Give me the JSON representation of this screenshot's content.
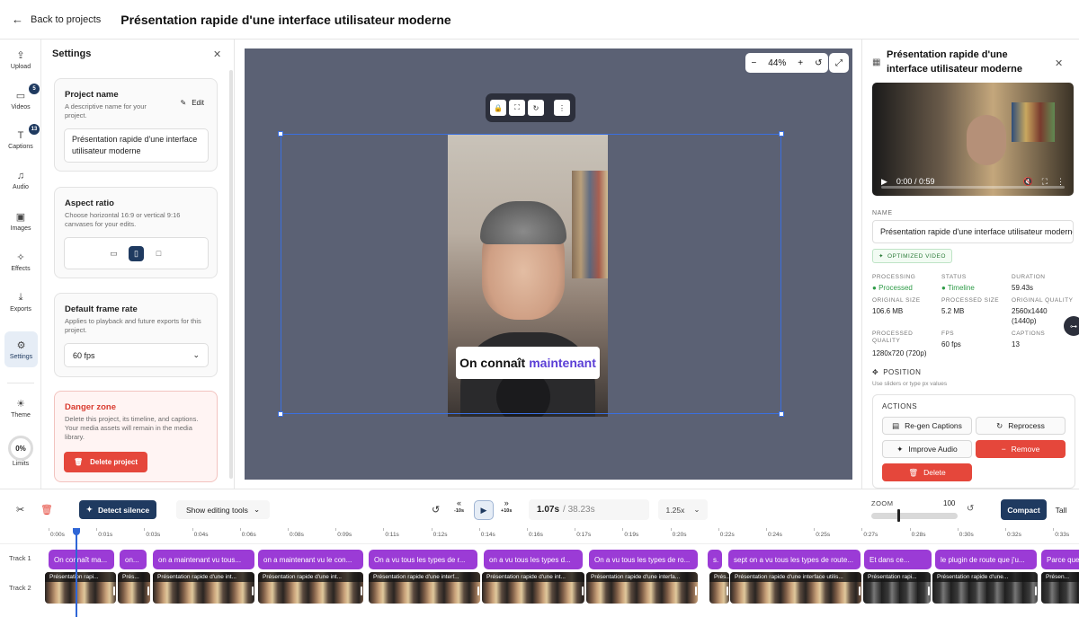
{
  "topbar": {
    "back_label": "Back to projects",
    "project_title": "Présentation rapide d'une interface utilisateur moderne"
  },
  "rail": {
    "items": [
      {
        "label": "Upload",
        "icon": "upload-icon"
      },
      {
        "label": "Videos",
        "icon": "video-icon",
        "badge": "5"
      },
      {
        "label": "Captions",
        "icon": "text-icon",
        "badge": "13"
      },
      {
        "label": "Audio",
        "icon": "music-icon"
      },
      {
        "label": "Images",
        "icon": "image-icon"
      },
      {
        "label": "Effects",
        "icon": "wand-icon"
      },
      {
        "label": "Exports",
        "icon": "download-icon"
      },
      {
        "label": "Settings",
        "icon": "gear-icon",
        "active": true
      }
    ],
    "theme_label": "Theme",
    "limits_value": "0%",
    "limits_label": "Limits"
  },
  "settings": {
    "title": "Settings",
    "project_name": {
      "heading": "Project name",
      "description": "A descriptive name for your project.",
      "edit_label": "Edit",
      "value": "Présentation rapide d'une interface utilisateur moderne"
    },
    "aspect_ratio": {
      "heading": "Aspect ratio",
      "description": "Choose horizontal 16:9 or vertical 9:16 canvases for your edits.",
      "selected": "vertical"
    },
    "frame_rate": {
      "heading": "Default frame rate",
      "description": "Applies to playback and future exports for this project.",
      "value": "60 fps"
    },
    "danger": {
      "heading": "Danger zone",
      "description": "Delete this project, its timeline, and captions. Your media assets will remain in the media library.",
      "button_label": "Delete project"
    }
  },
  "canvas": {
    "zoom_value": "44%",
    "caption_text": "On connaît",
    "caption_highlight": "maintenant"
  },
  "inspector": {
    "title": "Présentation rapide d'une interface utilisateur moderne",
    "player_time": "0:00 / 0:59",
    "name_label": "NAME",
    "name_value": "Présentation rapide d'une interface utilisateur moderne",
    "optimized_badge": "OPTIMIZED VIDEO",
    "meta": [
      {
        "label": "PROCESSING",
        "value": "Processed",
        "status": true
      },
      {
        "label": "STATUS",
        "value": "Timeline",
        "status": true
      },
      {
        "label": "DURATION",
        "value": "59.43s"
      },
      {
        "label": "ORIGINAL SIZE",
        "value": "106.6 MB"
      },
      {
        "label": "PROCESSED SIZE",
        "value": "5.2 MB"
      },
      {
        "label": "ORIGINAL QUALITY",
        "value": "2560x1440 (1440p)"
      },
      {
        "label": "PROCESSED QUALITY",
        "value": "1280x720 (720p)"
      },
      {
        "label": "FPS",
        "value": "60 fps"
      },
      {
        "label": "CAPTIONS",
        "value": "13"
      }
    ],
    "position_title": "POSITION",
    "position_hint": "Use sliders or type px values",
    "actions_title": "ACTIONS",
    "actions": {
      "regen": "Re-gen Captions",
      "reprocess": "Reprocess",
      "improve_audio": "Improve Audio",
      "remove": "Remove",
      "delete": "Delete"
    }
  },
  "toolbar": {
    "detect_silence": "Detect silence",
    "show_tools": "Show editing tools",
    "back10": "-10s",
    "fwd10": "+10s",
    "current_time": "1.07s",
    "total_time": "/ 38.23s",
    "speed": "1.25x",
    "zoom_label": "ZOOM",
    "zoom_value": "100",
    "compact": "Compact",
    "tall": "Tall"
  },
  "timeline": {
    "ticks": [
      "0:00s",
      "0:01s",
      "0:03s",
      "0:04s",
      "0:06s",
      "0:08s",
      "0:09s",
      "0:11s",
      "0:12s",
      "0:14s",
      "0:16s",
      "0:17s",
      "0:19s",
      "0:20s",
      "0:22s",
      "0:24s",
      "0:25s",
      "0:27s",
      "0:28s",
      "0:30s",
      "0:32s",
      "0:33s"
    ],
    "track1_label": "Track 1",
    "track2_label": "Track 2",
    "caption_clips": [
      "On connaît ma...",
      "on...",
      "on a maintenant vu tous...",
      "on a maintenant vu le con...",
      "On a vu tous les types de r...",
      "on a vu tous les types d...",
      "On a vu tous les types de ro...",
      "s.",
      "sept on a vu tous les types de route...",
      "Et dans ce...",
      "le plugin de route que j'u...",
      "Parce que..."
    ],
    "video_clips": [
      "Présentation rapi...",
      "Prés...",
      "Présentation rapide d'une int...",
      "Présentation rapide d'une int...",
      "Présentation rapide d'une interf...",
      "Présentation rapide d'une int...",
      "Présentation rapide d'une interfa...",
      "Prés...",
      "Présentation rapide d'une interface utilis...",
      "Présentation rapi...",
      "Présentation rapide d'une...",
      "Présen..."
    ]
  }
}
